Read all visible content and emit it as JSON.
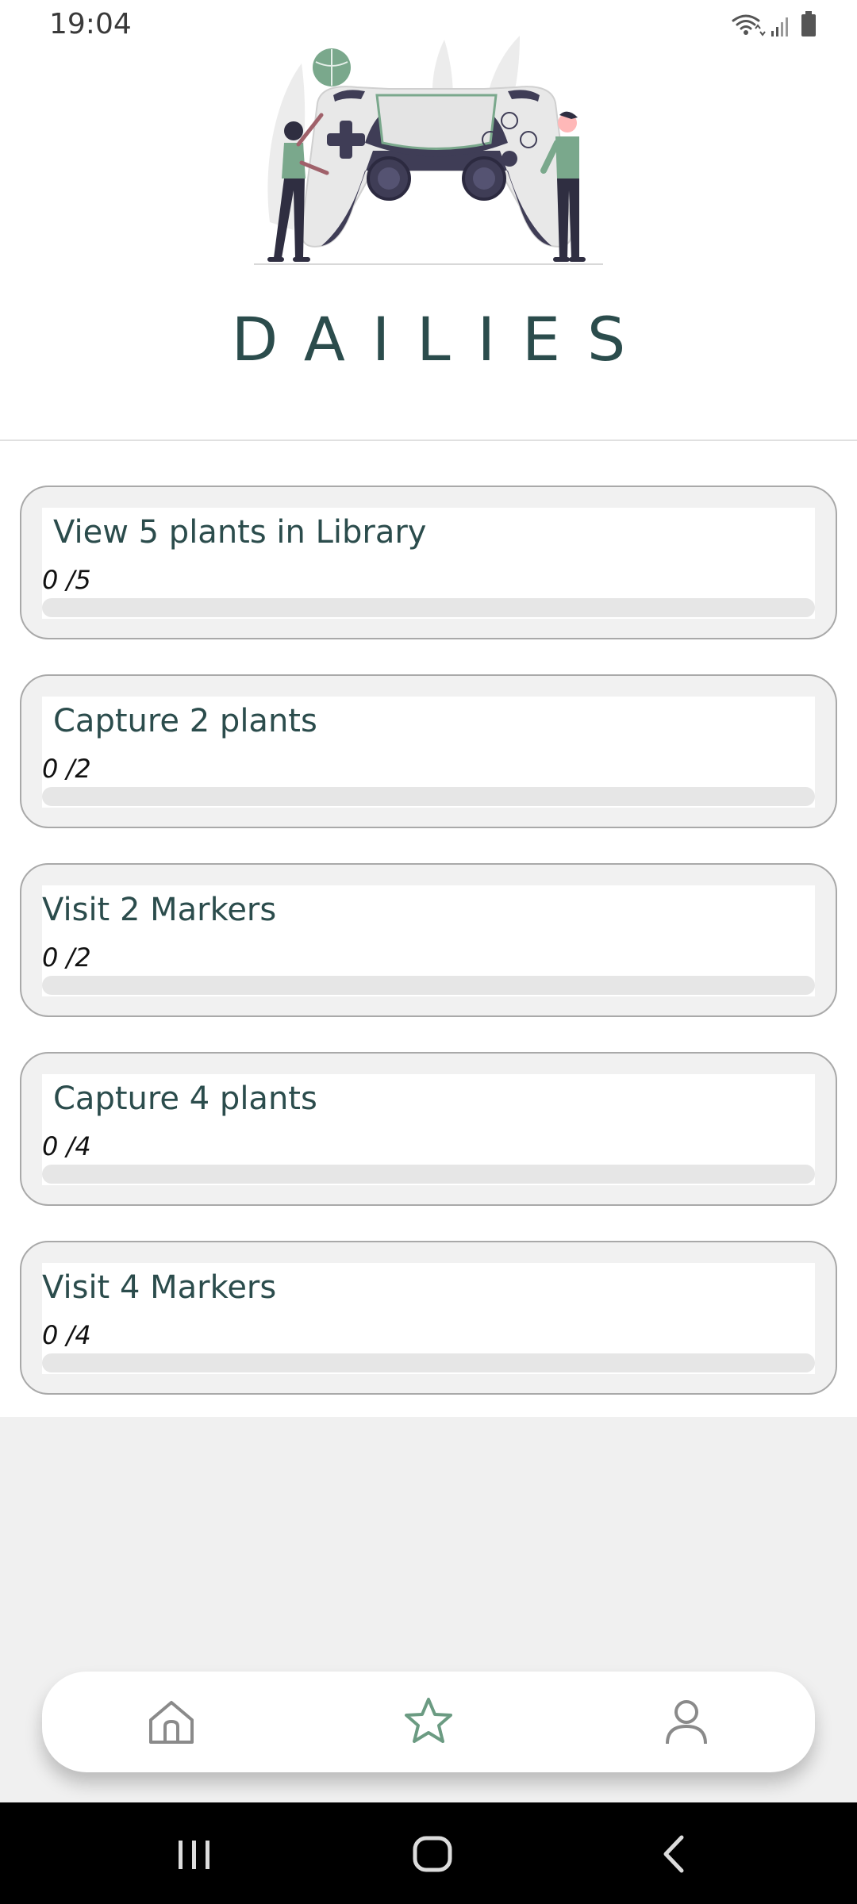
{
  "status_bar": {
    "time": "19:04"
  },
  "header": {
    "title": "DAILIES"
  },
  "tasks": [
    {
      "title": "View 5 plants in Library",
      "progress_text": "0 /5",
      "progress": 0
    },
    {
      "title": "Capture 2 plants",
      "progress_text": "0 /2",
      "progress": 0
    },
    {
      "title": "Visit 2 Markers",
      "progress_text": "0 /2",
      "progress": 0
    },
    {
      "title": "Capture 4 plants",
      "progress_text": "0 /4",
      "progress": 0
    },
    {
      "title": "Visit 4 Markers",
      "progress_text": "0 /4",
      "progress": 0
    }
  ],
  "bottom_nav": {
    "items": [
      {
        "icon": "home-icon",
        "active": false
      },
      {
        "icon": "star-icon",
        "active": true
      },
      {
        "icon": "person-icon",
        "active": false
      }
    ]
  },
  "colors": {
    "title": "#2b4c4c",
    "active_nav": "#6b9b82",
    "inactive_nav": "#8a8a8a",
    "bar_fill": "#7aa88c"
  }
}
